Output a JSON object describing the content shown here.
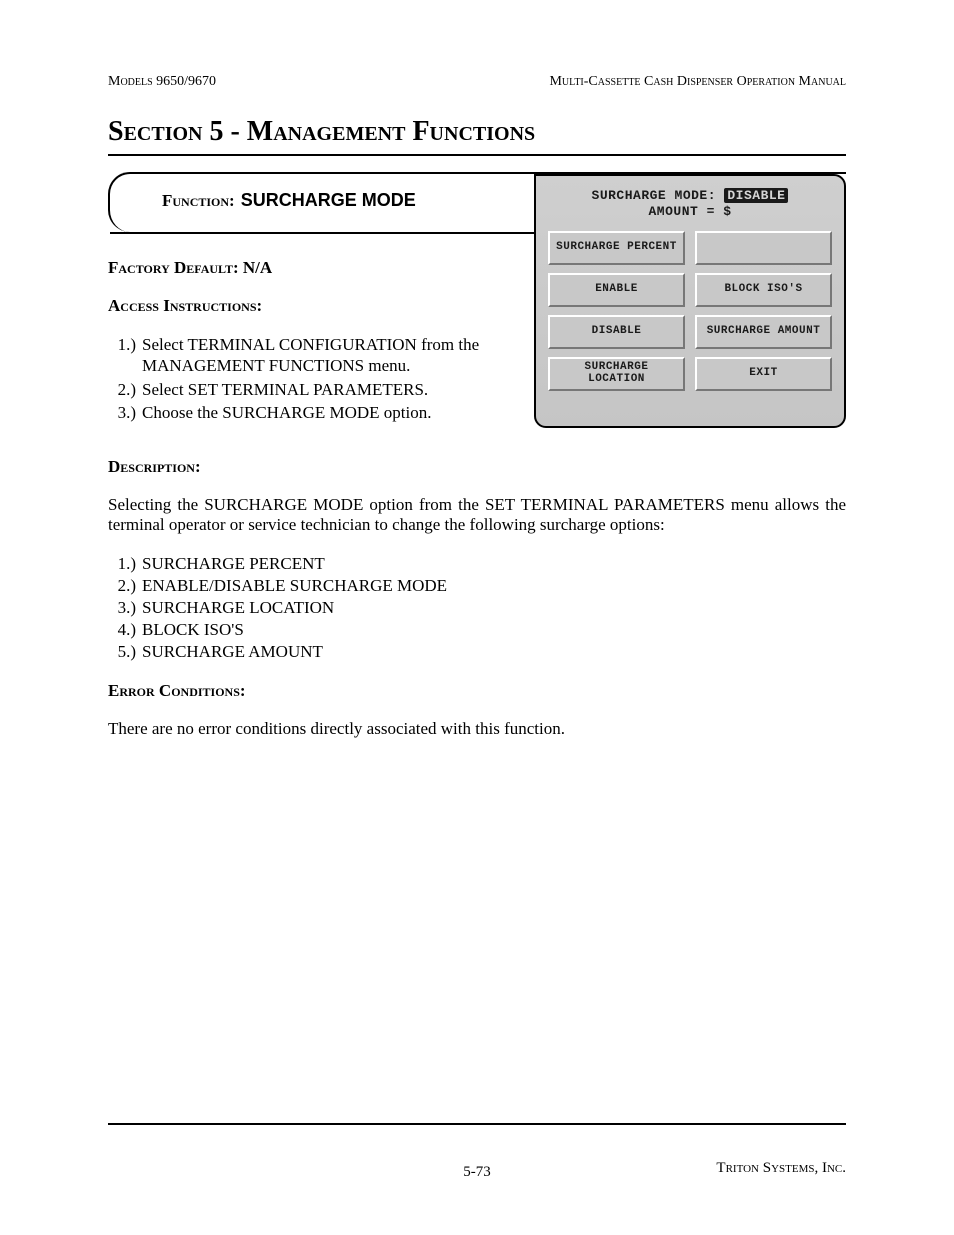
{
  "header": {
    "left": "Models 9650/9670",
    "right": "Multi-Cassette Cash Dispenser Operation Manual"
  },
  "section_title": "Section 5 - Management Functions",
  "function": {
    "label": "Function:",
    "name": "SURCHARGE MODE"
  },
  "factory_default": {
    "label": "Factory Default:",
    "value": "N/A"
  },
  "access": {
    "label": "Access Instructions:",
    "items": [
      "Select TERMINAL CONFIGURATION from the MANAGEMENT FUNCTIONS menu.",
      "Select SET TERMINAL PARAMETERS.",
      "Choose the SURCHARGE MODE option."
    ]
  },
  "terminal": {
    "line1_prefix": "SURCHARGE MODE:",
    "line1_value": "DISABLE",
    "line2": "AMOUNT = $",
    "buttons": [
      "SURCHARGE PERCENT",
      "",
      "ENABLE",
      "BLOCK ISO'S",
      "DISABLE",
      "SURCHARGE AMOUNT",
      "SURCHARGE LOCATION",
      "EXIT"
    ]
  },
  "description": {
    "label": "Description:",
    "para": "Selecting the SURCHARGE MODE option from the SET TERMINAL PARAMETERS menu allows the terminal operator or service technician to change the following surcharge options:",
    "options": [
      "SURCHARGE PERCENT",
      "ENABLE/DISABLE SURCHARGE MODE",
      "SURCHARGE LOCATION",
      "BLOCK ISO'S",
      "SURCHARGE AMOUNT"
    ]
  },
  "error": {
    "label": "Error Conditions:",
    "para": "There are no error conditions directly associated with this function."
  },
  "footer": {
    "company": "Triton Systems, Inc.",
    "page": "5-73"
  }
}
